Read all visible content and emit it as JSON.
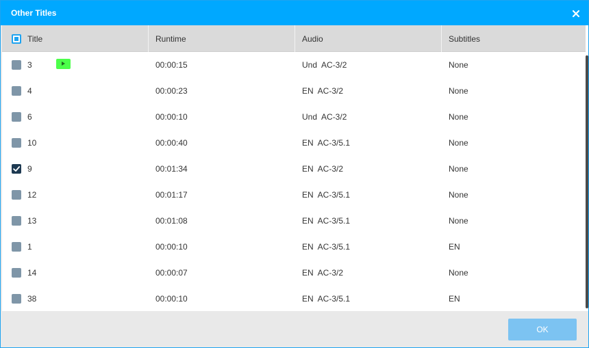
{
  "dialog": {
    "title": "Other Titles",
    "ok_label": "OK"
  },
  "columns": {
    "title": "Title",
    "runtime": "Runtime",
    "audio": "Audio",
    "subtitles": "Subtitles"
  },
  "rows": [
    {
      "title": "3",
      "runtime": "00:00:15",
      "audio": "Und  AC-3/2",
      "subtitles": "None",
      "checked": false,
      "has_play": true
    },
    {
      "title": "4",
      "runtime": "00:00:23",
      "audio": "EN  AC-3/2",
      "subtitles": "None",
      "checked": false,
      "has_play": false
    },
    {
      "title": "6",
      "runtime": "00:00:10",
      "audio": "Und  AC-3/2",
      "subtitles": "None",
      "checked": false,
      "has_play": false
    },
    {
      "title": "10",
      "runtime": "00:00:40",
      "audio": "EN  AC-3/5.1",
      "subtitles": "None",
      "checked": false,
      "has_play": false
    },
    {
      "title": "9",
      "runtime": "00:01:34",
      "audio": "EN  AC-3/2",
      "subtitles": "None",
      "checked": true,
      "has_play": false
    },
    {
      "title": "12",
      "runtime": "00:01:17",
      "audio": "EN  AC-3/5.1",
      "subtitles": "None",
      "checked": false,
      "has_play": false
    },
    {
      "title": "13",
      "runtime": "00:01:08",
      "audio": "EN  AC-3/5.1",
      "subtitles": "None",
      "checked": false,
      "has_play": false
    },
    {
      "title": "1",
      "runtime": "00:00:10",
      "audio": "EN  AC-3/5.1",
      "subtitles": "EN",
      "checked": false,
      "has_play": false
    },
    {
      "title": "14",
      "runtime": "00:00:07",
      "audio": "EN  AC-3/2",
      "subtitles": "None",
      "checked": false,
      "has_play": false
    },
    {
      "title": "38",
      "runtime": "00:00:10",
      "audio": "EN  AC-3/5.1",
      "subtitles": "EN",
      "checked": false,
      "has_play": false
    }
  ],
  "colors": {
    "accent": "#00a8ff",
    "checkbox_unchecked": "#7f96a8",
    "checkbox_checked": "#1e3a52",
    "play_button": "#4cff4a",
    "ok_button": "#7cc3f2"
  },
  "icons": {
    "close": "close-icon",
    "play": "play-icon",
    "check": "checkmark-icon"
  }
}
